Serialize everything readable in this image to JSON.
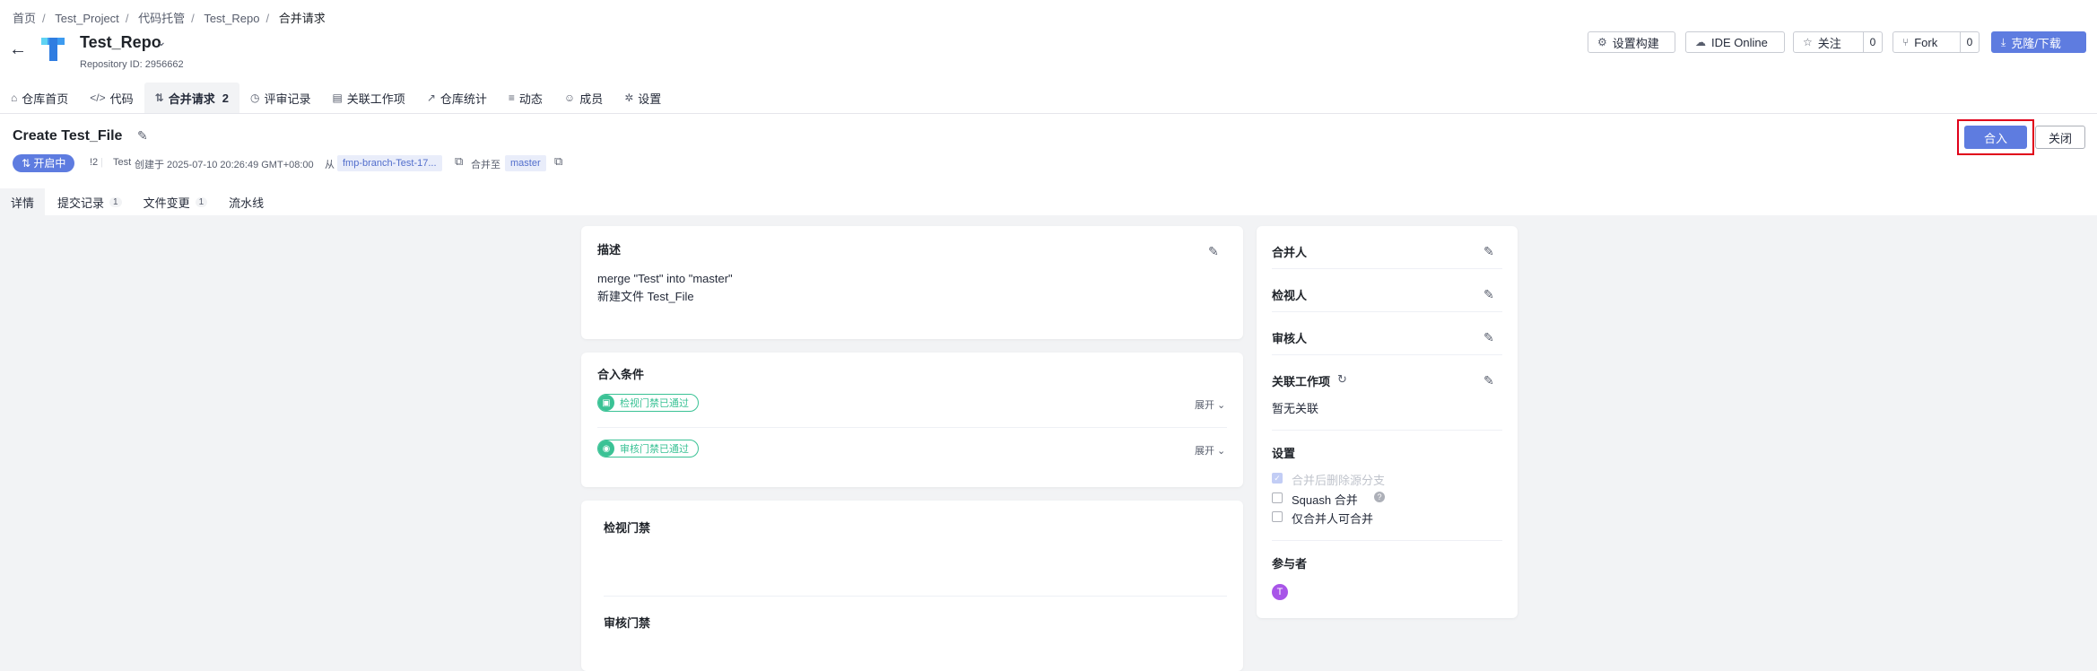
{
  "breadcrumb": [
    "首页",
    "Test_Project",
    "代码托管",
    "Test_Repo",
    "合并请求"
  ],
  "repo": {
    "name": "Test_Repo",
    "id_label": "Repository ID: 2956662"
  },
  "header_buttons": {
    "build": "设置构建",
    "ide": "IDE Online",
    "watch": "关注",
    "watch_count": "0",
    "fork": "Fork",
    "fork_count": "0",
    "clone": "克隆/下载"
  },
  "nav": {
    "items": [
      "仓库首页",
      "代码",
      "合并请求",
      "评审记录",
      "关联工作项",
      "仓库统计",
      "动态",
      "成员",
      "设置"
    ],
    "merge_count": "2"
  },
  "pr": {
    "title": "Create Test_File",
    "status": "开启中",
    "number": "!2",
    "author": "Test",
    "created": "创建于 2025-07-10 20:26:49 GMT+08:00",
    "from_label": "从",
    "source_branch": "fmp-branch-Test-17...",
    "to_label": "合并至",
    "target_branch": "master"
  },
  "actions": {
    "merge": "合入",
    "close": "关闭"
  },
  "subtabs": {
    "details": "详情",
    "commits": "提交记录",
    "commits_count": "1",
    "files": "文件变更",
    "files_count": "1",
    "pipeline": "流水线"
  },
  "description": {
    "title": "描述",
    "line1": "merge \"Test\" into \"master\"",
    "line2": "新建文件 Test_File"
  },
  "conditions": {
    "title": "合入条件",
    "items": [
      {
        "label": "检视门禁已通过",
        "expand": "展开"
      },
      {
        "label": "审核门禁已通过",
        "expand": "展开"
      }
    ]
  },
  "gates": {
    "review_gate": "检视门禁",
    "approval_gate": "审核门禁"
  },
  "sidebar": {
    "merger": "合并人",
    "reviewer": "检视人",
    "approver": "审核人",
    "work_items": "关联工作项",
    "no_link": "暂无关联",
    "settings": "设置",
    "opt_delete_branch": "合并后删除源分支",
    "opt_squash": "Squash 合并",
    "opt_only_merger": "仅合并人可合并",
    "participants": "参与者",
    "participant_initial": "T"
  },
  "colors": {
    "primary": "#5e7ce0",
    "success": "#3ac295",
    "highlight": "#e0001a",
    "avatar": "#a855e8"
  }
}
